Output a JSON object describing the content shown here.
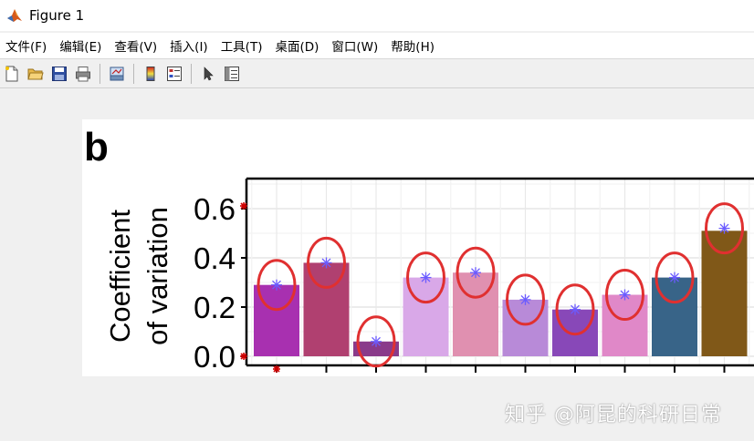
{
  "window": {
    "title": "Figure 1"
  },
  "menu": [
    {
      "label": "文件(F)"
    },
    {
      "label": "编辑(E)"
    },
    {
      "label": "查看(V)"
    },
    {
      "label": "插入(I)"
    },
    {
      "label": "工具(T)"
    },
    {
      "label": "桌面(D)"
    },
    {
      "label": "窗口(W)"
    },
    {
      "label": "帮助(H)"
    }
  ],
  "toolbar": {
    "icons": [
      "new-figure-icon",
      "open-file-icon",
      "save-icon",
      "print-icon",
      "link-plot-icon",
      "colorbar-icon",
      "legend-icon",
      "select-pointer-icon",
      "property-editor-icon"
    ]
  },
  "panel_label": "b",
  "colors": {
    "annotation_circle": "#e03030",
    "point_marker": "#6b5cff",
    "axis_marker": "#d00000"
  },
  "chart_data": {
    "type": "bar",
    "ylabel_line1": "Coefficient",
    "ylabel_line2": "of variation",
    "ylim": [
      0,
      0.7
    ],
    "yticks": [
      "0.0",
      "0.2",
      "0.4",
      "0.6"
    ],
    "ytick_values": [
      0,
      0.2,
      0.4,
      0.6
    ],
    "grid": true,
    "values": [
      0.29,
      0.38,
      0.06,
      0.32,
      0.34,
      0.23,
      0.19,
      0.25,
      0.32,
      0.51
    ],
    "colors": [
      "#a830b0",
      "#b04070",
      "#8a3a8a",
      "#d9a8e8",
      "#e090b0",
      "#b88ad8",
      "#8848b8",
      "#e088c8",
      "#386488",
      "#805818"
    ],
    "markers": [
      0.29,
      0.38,
      0.06,
      0.32,
      0.34,
      0.23,
      0.19,
      0.25,
      0.32,
      0.52
    ]
  },
  "watermark": "知乎 @阿昆的科研日常"
}
